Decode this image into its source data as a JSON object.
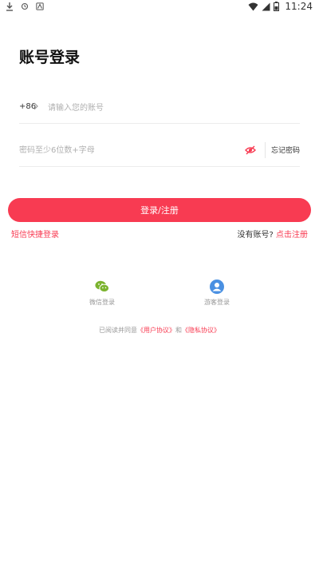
{
  "status_bar": {
    "time": "11:24",
    "left_icons": [
      "download-icon",
      "sync-icon",
      "app-notification-icon"
    ],
    "right_icons": [
      "wifi-icon",
      "signal-icon",
      "battery-icon"
    ]
  },
  "page": {
    "title": "账号登录"
  },
  "phone_field": {
    "country_code": "+86",
    "placeholder": "请输入您的账号",
    "value": ""
  },
  "password_field": {
    "placeholder": "密码至少6位数+字母",
    "value": "",
    "visibility_icon": "eye-closed-icon",
    "forgot_label": "忘记密码"
  },
  "login_button": {
    "label": "登录/注册",
    "color": "#f83b52"
  },
  "links": {
    "sms_login": "短信快捷登录",
    "no_account": "没有账号?",
    "register": "点击注册"
  },
  "third_party": [
    {
      "label": "微信登录",
      "icon": "wechat-icon",
      "color": "#7bb32e"
    },
    {
      "label": "游客登录",
      "icon": "guest-user-icon",
      "color": "#4a90e2"
    }
  ],
  "agreement": {
    "prefix": "已阅读并同意",
    "user_agreement": "《用户协议》",
    "and": "和",
    "privacy_policy": "《隐私协议》"
  }
}
